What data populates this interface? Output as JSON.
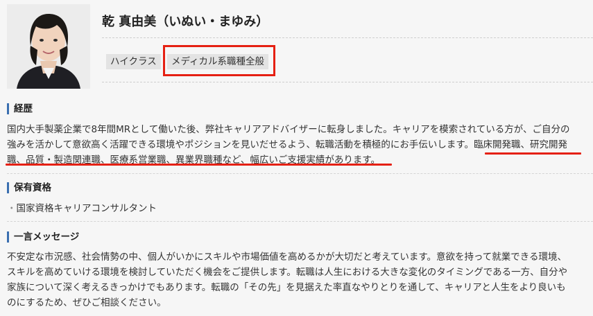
{
  "profile": {
    "name": "乾 真由美（いぬい・まゆみ）",
    "tags": [
      "ハイクラス",
      "メディカル系職種全般"
    ]
  },
  "career": {
    "heading": "経歴",
    "lines": [
      "国内大手製薬企業で8年間MRとして働いた後、弊社キャリアアドバイザーに転身しました。キャリアを模索されている方が、ご自分の",
      "強みを活かして意欲高く活躍できる環境やポジションを見いだせるよう、転職活動を積極的にお手伝いします。臨床開発職、研究開発",
      "職、品質・製造関連職、医療系営業職、異業界職種など、幅広いご支援実績があります。"
    ]
  },
  "qualifications": {
    "heading": "保有資格",
    "items": [
      "国家資格キャリアコンサルタント"
    ]
  },
  "message": {
    "heading": "一言メッセージ",
    "lines": [
      "不安定な市況感、社会情勢の中、個人がいかにスキルや市場価値を高めるかが大切だと考えています。意欲を持って就業できる環境、",
      "スキルを高めていける環境を検討していただく機会をご提供します。転職は人生における大きな変化のタイミングである一方、自分や",
      "家族について深く考えるきっかけでもあります。転職の「その先」を見据えた率直なやりとりを通して、キャリアと人生をより良いも",
      "のにするため、ぜひご相談ください。"
    ]
  },
  "colors": {
    "background": "#f6f6f6",
    "accent_bar": "#3a6fb0",
    "tag_bg": "#e3e3e3",
    "highlight_red": "#e52012"
  }
}
